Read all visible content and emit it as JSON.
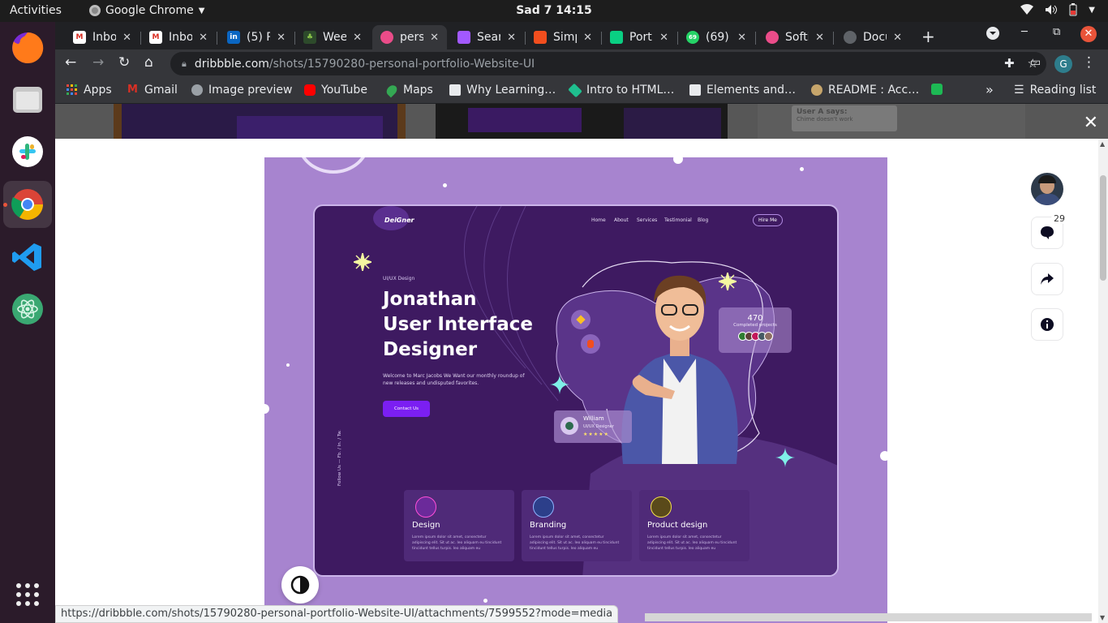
{
  "system_bar": {
    "activities": "Activities",
    "app_name": "Google Chrome",
    "clock": "Sad 7  14:15"
  },
  "dock": {
    "items": [
      "Firefox",
      "Files",
      "Slack",
      "Google Chrome",
      "Visual Studio Code",
      "Atom",
      "Show Applications"
    ]
  },
  "tabs": [
    {
      "title": "Inbo",
      "favicon": "gmail-icon"
    },
    {
      "title": "Inbo",
      "favicon": "gmail-icon"
    },
    {
      "title": "(5) P",
      "favicon": "linkedin-icon"
    },
    {
      "title": "Wee",
      "favicon": "tree-icon"
    },
    {
      "title": "pers",
      "favicon": "dribbble-icon",
      "active": true
    },
    {
      "title": "Sear",
      "favicon": "figma-icon"
    },
    {
      "title": "Simp",
      "favicon": "figma-icon"
    },
    {
      "title": "Port",
      "favicon": "figma-icon"
    },
    {
      "title": "(69)",
      "favicon": "whatsapp-icon",
      "badge": "69"
    },
    {
      "title": "Softi",
      "favicon": "dribbble-icon"
    },
    {
      "title": "Docu",
      "favicon": "globe-icon"
    }
  ],
  "address_bar": {
    "host": "dribbble.com",
    "path": "/shots/15790280-personal-portfolio-Website-UI",
    "profile_initial": "G"
  },
  "bookmarks": [
    {
      "label": "Apps"
    },
    {
      "label": "Gmail"
    },
    {
      "label": "Image preview"
    },
    {
      "label": "YouTube"
    },
    {
      "label": "Maps"
    },
    {
      "label": "Why Learning…"
    },
    {
      "label": "Intro to HTML…"
    },
    {
      "label": "Elements and…"
    },
    {
      "label": "README : Acc…"
    }
  ],
  "reading_list": "Reading list",
  "more_bookmarks": "»",
  "backdrop_text": {
    "line1": "User A says:",
    "line2": "Chime doesn't work"
  },
  "side_actions": {
    "comment_count": "29"
  },
  "mockup": {
    "logo": "DeiGner",
    "nav": [
      "Home",
      "About",
      "Services",
      "Testimonial",
      "Blog"
    ],
    "hire": "Hire Me",
    "eyebrow": "UI/UX Design",
    "headline": [
      "Jonathan",
      "User Interface",
      "Designer"
    ],
    "lead": "Welcome to Marc Jacobs We Want our monthly roundup of new releases and undisputed favorites.",
    "cta": "Contact Us",
    "follow": "Follow Us  —  Fb.  /  In.  /  Tw.",
    "stat_number": "470",
    "stat_label": "Completed projects",
    "reviewer_name": "William",
    "reviewer_role": "UI/UX Designer",
    "reviewer_stars": "★★★★★",
    "services": [
      {
        "title": "Design",
        "desc": "Lorem ipsum dolor sit amet, consectetur adipiscing elit. Sit ut ac. leo aliquam eu tincidunt tincidunt tellus turpis. leo aliquam eu"
      },
      {
        "title": "Branding",
        "desc": "Lorem ipsum dolor sit amet, consectetur adipiscing elit. Sit ut ac. leo aliquam eu tincidunt tincidunt tellus turpis. leo aliquam eu"
      },
      {
        "title": "Product design",
        "desc": "Lorem ipsum dolor sit amet, consectetur adipiscing elit. Sit ut ac. leo aliquam eu tincidunt tincidunt tellus turpis. leo aliquam eu"
      }
    ]
  },
  "status_url": "https://dribbble.com/shots/15790280-personal-portfolio-Website-UI/attachments/7599552?mode=media",
  "colors": {
    "mockup_bg": "#3e1a61",
    "shot_bg": "#a784cf",
    "cta": "#7b1ff2",
    "accent_star": "#f4f7a0",
    "accent_sparkle": "#7ff0e8"
  }
}
